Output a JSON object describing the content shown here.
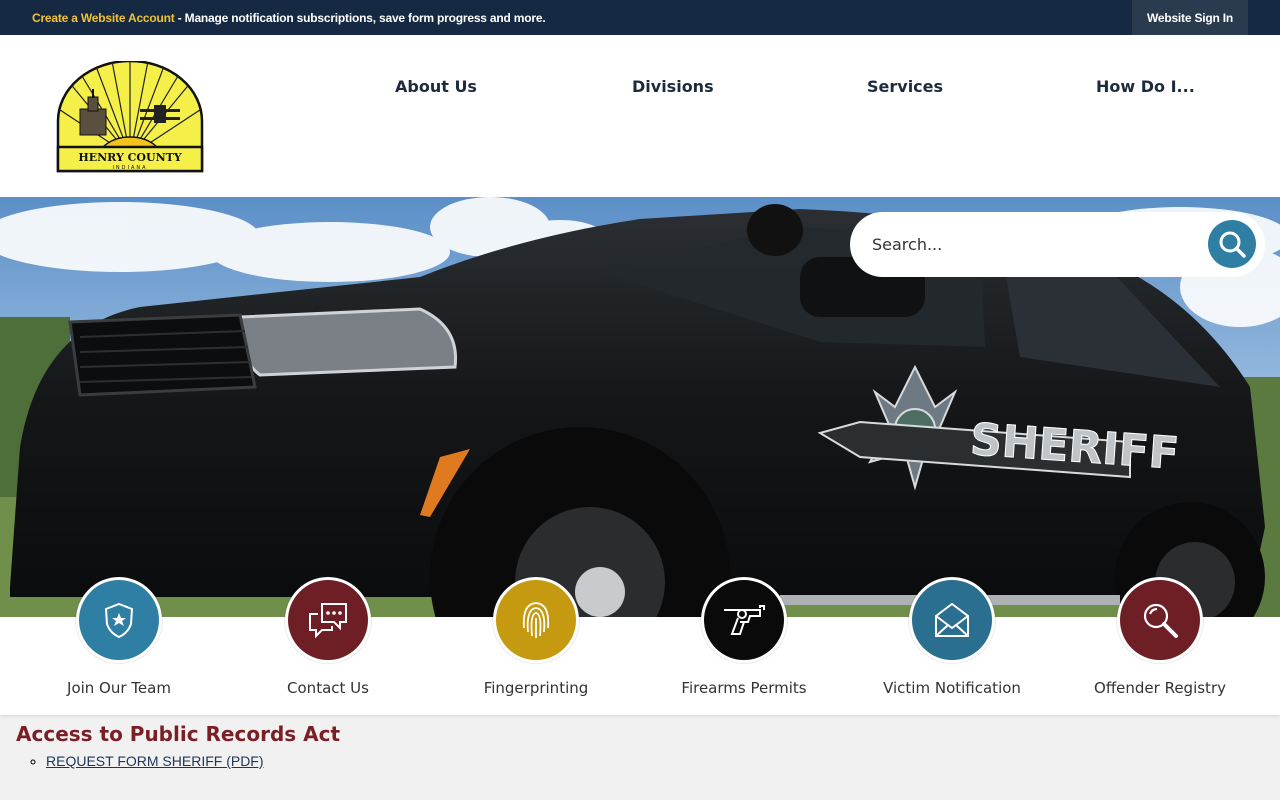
{
  "topbar": {
    "create_account_link": "Create a Website Account",
    "notice_text": " - Manage notification subscriptions, save form progress and more.",
    "sign_in": "Website Sign In"
  },
  "logo": {
    "text_line1": "HENRY COUNTY",
    "text_line2": "INDIANA"
  },
  "nav": {
    "items": [
      "About Us",
      "Divisions",
      "Services",
      "How Do I..."
    ]
  },
  "hero": {
    "vehicle_door_text": "SHERIFF"
  },
  "search": {
    "placeholder": "Search..."
  },
  "quick_links": [
    {
      "label": "Join Our Team",
      "icon": "badge-icon",
      "color": "#2f7fa5"
    },
    {
      "label": "Contact Us",
      "icon": "chat-icon",
      "color": "#6e1f26"
    },
    {
      "label": "Fingerprinting",
      "icon": "fingerprint-icon",
      "color": "#c69a10"
    },
    {
      "label": "Firearms Permits",
      "icon": "revolver-icon",
      "color": "#0a0a0a"
    },
    {
      "label": "Victim Notification",
      "icon": "envelope-icon",
      "color": "#2a6f8f"
    },
    {
      "label": "Offender Registry",
      "icon": "magnifier-icon",
      "color": "#6e1f26"
    }
  ],
  "content": {
    "heading": "Access to Public Records Act",
    "links": [
      "REQUEST FORM SHERIFF (PDF)"
    ]
  },
  "colors": {
    "topbar_bg": "#152a42",
    "accent_gold": "#f1c232",
    "nav_text": "#1d2b3c",
    "heading_red": "#7a1f25"
  }
}
